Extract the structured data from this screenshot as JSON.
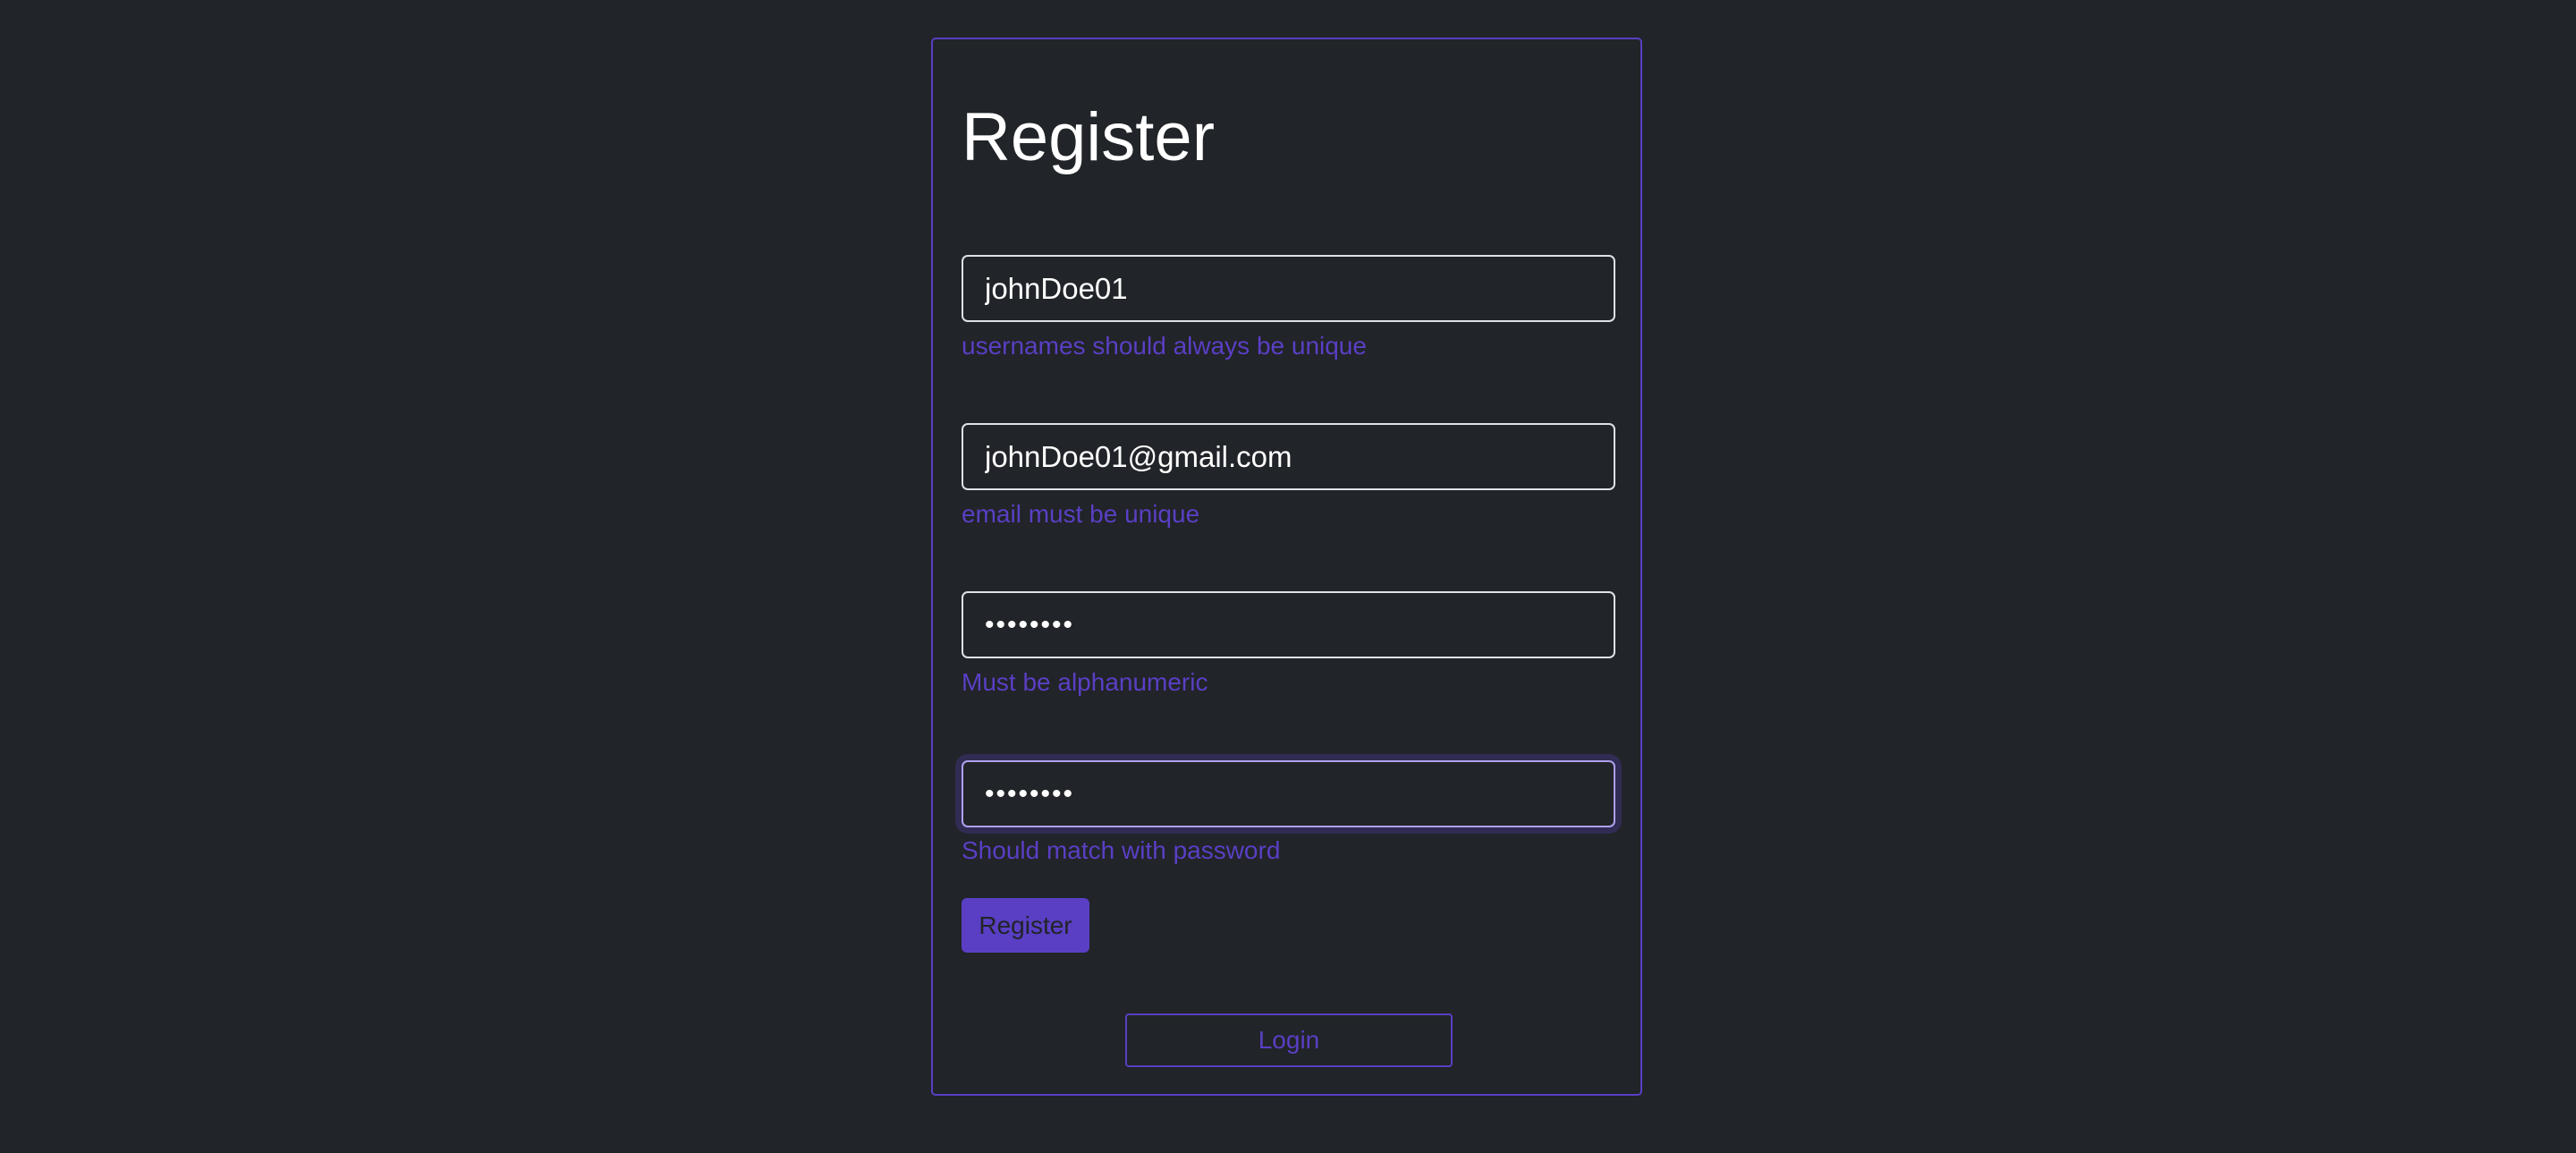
{
  "form": {
    "title": "Register",
    "fields": [
      {
        "value": "johnDoe01",
        "hint": "usernames should always be unique"
      },
      {
        "value": "johnDoe01@gmail.com",
        "hint": "email must be unique"
      },
      {
        "value": "12345678",
        "hint": "Must be alphanumeric"
      },
      {
        "value": "12345678",
        "hint": "Should match with password"
      }
    ],
    "register_label": "Register",
    "login_label": "Login"
  },
  "colors": {
    "background": "#212428",
    "accent": "#5a3fc4",
    "text": "#ffffff"
  }
}
